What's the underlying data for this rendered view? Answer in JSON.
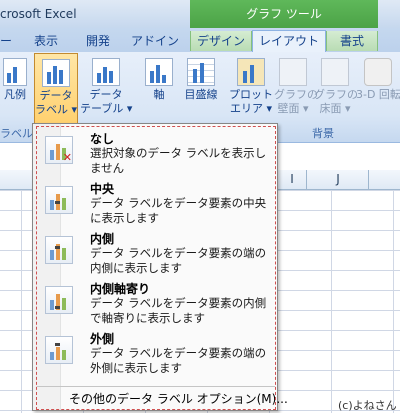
{
  "window": {
    "title": "crosoft Excel",
    "context_header": "グラフ ツール"
  },
  "tabs": [
    {
      "label": "ー"
    },
    {
      "label": "表示"
    },
    {
      "label": "開発"
    },
    {
      "label": "アドイン"
    },
    {
      "label": "デザイン"
    },
    {
      "label": "レイアウト"
    },
    {
      "label": "書式"
    }
  ],
  "ribbon": {
    "buttons": [
      {
        "line1": "凡例",
        "line2": ""
      },
      {
        "line1": "データ",
        "line2": "ラベル ▾"
      },
      {
        "line1": "データ",
        "line2": "テーブル ▾"
      },
      {
        "line1": "軸",
        "line2": ""
      },
      {
        "line1": "目盛線",
        "line2": ""
      },
      {
        "line1": "プロット",
        "line2": "エリア ▾"
      },
      {
        "line1": "グラフの",
        "line2": "壁面 ▾"
      },
      {
        "line1": "グラフの",
        "line2": "床面 ▾"
      },
      {
        "line1": "3-D 回転",
        "line2": ""
      }
    ],
    "group_left": "ラベル",
    "group_background": "背景"
  },
  "columns": [
    "I",
    "J"
  ],
  "dropdown": {
    "items": [
      {
        "title": "なし",
        "desc": "選択対象のデータ ラベルを表示しません"
      },
      {
        "title": "中央",
        "desc": "データ ラベルをデータ要素の中央に表示します"
      },
      {
        "title": "内側",
        "desc": "データ ラベルをデータ要素の端の内側に表示します"
      },
      {
        "title": "内側軸寄り",
        "desc": "データ ラベルをデータ要素の内側で軸寄りに表示します"
      },
      {
        "title": "外側",
        "desc": "データ ラベルをデータ要素の端の外側に表示します"
      }
    ],
    "footer": "その他のデータ ラベル オプション(M)..."
  },
  "credit": "(c)よねさん",
  "colors": {
    "accent_green": "#4aa145",
    "ribbon_blue": "#15428b",
    "pressed": "#ffd06d"
  }
}
